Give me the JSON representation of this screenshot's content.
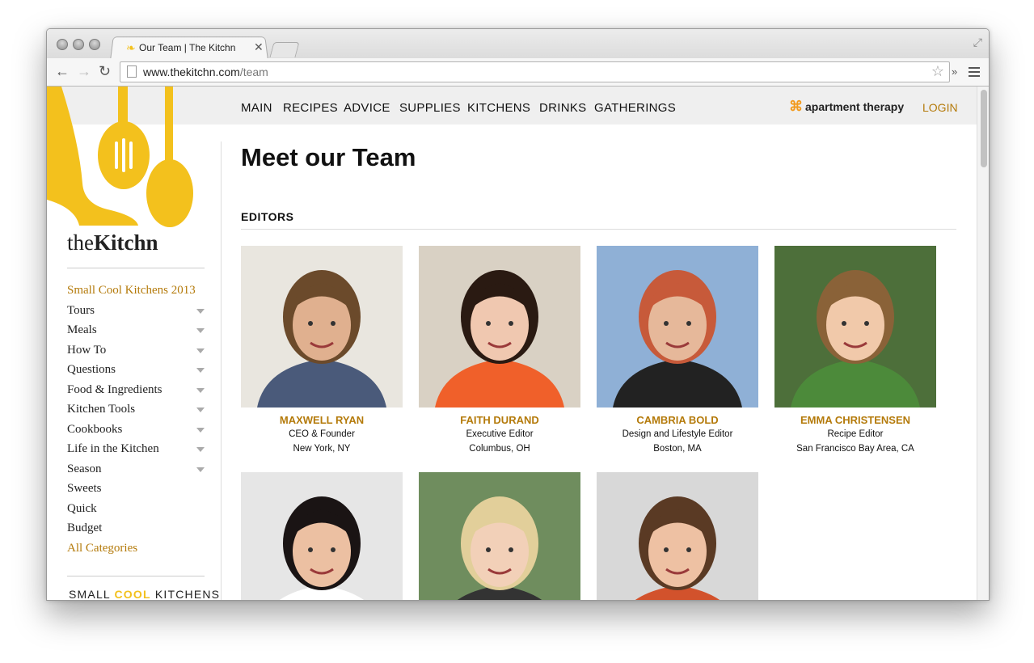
{
  "browser": {
    "tab_title": "Our Team | The Kitchn",
    "url_host": "www.thekitchn.com",
    "url_path": "/team"
  },
  "nav": {
    "items": [
      "MAIN",
      "RECIPES",
      "ADVICE",
      "SUPPLIES",
      "KITCHENS",
      "DRINKS",
      "GATHERINGS"
    ],
    "partner": "apartment therapy",
    "login": "LOGIN"
  },
  "sidebar": {
    "brand_prefix": "the",
    "brand_name": "Kitchn",
    "items": [
      {
        "label": "Small Cool Kitchens 2013",
        "highlight": true,
        "has_arrow": false
      },
      {
        "label": "Tours",
        "highlight": false,
        "has_arrow": true
      },
      {
        "label": "Meals",
        "highlight": false,
        "has_arrow": true
      },
      {
        "label": "How To",
        "highlight": false,
        "has_arrow": true
      },
      {
        "label": "Questions",
        "highlight": false,
        "has_arrow": true
      },
      {
        "label": "Food & Ingredients",
        "highlight": false,
        "has_arrow": true
      },
      {
        "label": "Kitchen Tools",
        "highlight": false,
        "has_arrow": true
      },
      {
        "label": "Cookbooks",
        "highlight": false,
        "has_arrow": true
      },
      {
        "label": "Life in the Kitchen",
        "highlight": false,
        "has_arrow": true
      },
      {
        "label": "Season",
        "highlight": false,
        "has_arrow": true
      },
      {
        "label": "Sweets",
        "highlight": false,
        "has_arrow": false
      },
      {
        "label": "Quick",
        "highlight": false,
        "has_arrow": false
      },
      {
        "label": "Budget",
        "highlight": false,
        "has_arrow": false
      },
      {
        "label": "All Categories",
        "highlight": true,
        "has_arrow": false
      }
    ],
    "promo_small": "SMALL",
    "promo_cool": "COOL",
    "promo_kitchens": "KITCHENS"
  },
  "main": {
    "title": "Meet our Team",
    "section": "EDITORS",
    "team": [
      {
        "name": "MAXWELL RYAN",
        "role": "CEO & Founder",
        "location": "New York, NY"
      },
      {
        "name": "FAITH DURAND",
        "role": "Executive Editor",
        "location": "Columbus, OH"
      },
      {
        "name": "CAMBRIA BOLD",
        "role": "Design and Lifestyle Editor",
        "location": "Boston, MA"
      },
      {
        "name": "EMMA CHRISTENSEN",
        "role": "Recipe Editor",
        "location": "San Francisco Bay Area, CA"
      },
      {
        "name": "",
        "role": "",
        "location": ""
      },
      {
        "name": "",
        "role": "",
        "location": ""
      },
      {
        "name": "",
        "role": "",
        "location": ""
      }
    ]
  },
  "colors": {
    "accent_gold": "#b47a0a",
    "logo_yellow": "#f3c11d",
    "partner_orange": "#f29a1d"
  }
}
